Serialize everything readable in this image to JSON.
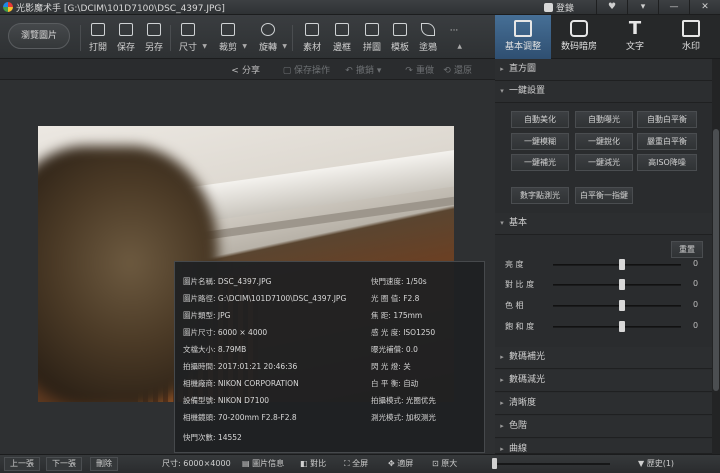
{
  "window": {
    "app_title": "光影魔术手",
    "file_path": "[G:\\DCIM\\101D7100\\DSC_4397.JPG]",
    "login_label": "登錄",
    "buttons": [
      "♥",
      "▾",
      "—",
      "✕"
    ]
  },
  "toolbar": {
    "browse_label": "瀏覽圖片",
    "tools": [
      {
        "label": "打開",
        "icon": "open-icon"
      },
      {
        "label": "保存",
        "icon": "save-icon"
      },
      {
        "label": "另存",
        "icon": "save-as-icon"
      },
      {
        "label": "尺寸",
        "icon": "resize-icon"
      },
      {
        "label": "裁剪",
        "icon": "crop-icon"
      },
      {
        "label": "旋轉",
        "icon": "rotate-icon"
      },
      {
        "label": "素材",
        "icon": "material-icon"
      },
      {
        "label": "邊框",
        "icon": "frame-icon"
      },
      {
        "label": "拼圖",
        "icon": "collage-icon"
      },
      {
        "label": "模板",
        "icon": "template-icon"
      },
      {
        "label": "塗鴉",
        "icon": "doodle-icon"
      }
    ],
    "more_label": "···"
  },
  "right_tabs": [
    {
      "label": "基本调整",
      "icon": "adjust-icon",
      "active": true
    },
    {
      "label": "数码暗房",
      "icon": "darkroom-icon",
      "active": false
    },
    {
      "label": "文字",
      "icon": "text-icon",
      "active": false
    },
    {
      "label": "水印",
      "icon": "watermark-icon",
      "active": false
    }
  ],
  "subbar": {
    "share": "分享",
    "save_operation": "保存操作",
    "undo": "撤銷",
    "redo": "重做",
    "restore": "還原"
  },
  "info_panel": {
    "left": [
      {
        "key": "圖片名稱:",
        "value": "DSC_4397.JPG"
      },
      {
        "key": "圖片路徑:",
        "value": "G:\\DCIM\\101D7100\\DSC_4397.JPG"
      },
      {
        "key": "圖片類型:",
        "value": "JPG"
      },
      {
        "key": "圖片尺寸:",
        "value": "6000 × 4000"
      },
      {
        "key": "文檔大小:",
        "value": "8.79MB"
      },
      {
        "key": "拍攝時間:",
        "value": "2017:01:21 20:46:36"
      },
      {
        "key": "相機廠商:",
        "value": "NIKON CORPORATION"
      },
      {
        "key": "設備型號:",
        "value": "NIKON D7100"
      },
      {
        "key": "相機鏡頭:",
        "value": "70-200mm  F2.8-F2.8"
      },
      {
        "key": "快門次數:",
        "value": "14552"
      }
    ],
    "right": [
      {
        "key": "快門速度:",
        "value": "1/50s"
      },
      {
        "key": "光 圈 值:",
        "value": "F2.8"
      },
      {
        "key": "焦    距:",
        "value": "175mm"
      },
      {
        "key": "感 光 度:",
        "value": "ISO1250"
      },
      {
        "key": "曝光補償:",
        "value": "0.0"
      },
      {
        "key": "閃 光 燈:",
        "value": "关"
      },
      {
        "key": "白 平 衡:",
        "value": "自动"
      },
      {
        "key": "拍攝模式:",
        "value": "光圈优先"
      },
      {
        "key": "測光模式:",
        "value": "加权测光"
      }
    ]
  },
  "panel": {
    "histogram": "直方圖",
    "one_click": "一鍵設置",
    "one_click_buttons": [
      "自動美化",
      "自動曝光",
      "自動白平衡",
      "一鍵模糊",
      "一鍵銳化",
      "嚴重白平衡",
      "一鍵補光",
      "一鍵減光",
      "高ISO降噪"
    ],
    "spot_metering": "數字點測光",
    "wb_one_click": "白平衡一指鍵",
    "basic": "基本",
    "reset": "重置",
    "sliders": [
      {
        "label": "亮    度",
        "value": "0",
        "level": 0
      },
      {
        "label": "對 比 度",
        "value": "0",
        "level": 0
      },
      {
        "label": "色    相",
        "value": "0",
        "level": 0
      },
      {
        "label": "飽 和 度",
        "value": "0",
        "level": 0
      }
    ],
    "sections_after": [
      "數碼補光",
      "數碼減光",
      "清晰度",
      "色階",
      "曲線"
    ]
  },
  "statusbar": {
    "prev": "上一張",
    "next": "下一張",
    "delete": "刪除",
    "size": "尺寸: 6000×4000",
    "image_info": "圖片信息",
    "compare": "對比",
    "fullscreen": "全屏",
    "fit": "適屏",
    "original": "原大",
    "history": "歷史(1)"
  }
}
